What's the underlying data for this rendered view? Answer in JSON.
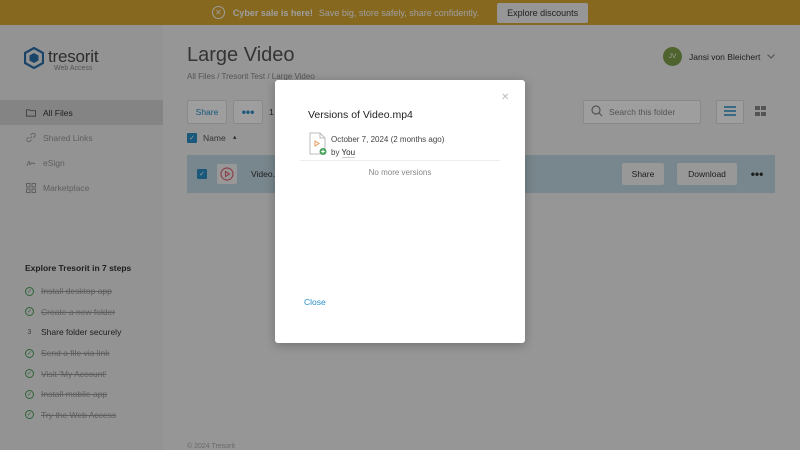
{
  "banner": {
    "bold": "Cyber sale is here!",
    "text": "Save big, store safely, share confidently.",
    "button": "Explore discounts"
  },
  "sidebar": {
    "logo": "tresorit",
    "logo_sub": "Web Access",
    "nav": [
      {
        "label": "All Files",
        "icon": "folder-icon"
      },
      {
        "label": "Shared Links",
        "icon": "link-icon"
      },
      {
        "label": "eSign",
        "icon": "signature-icon"
      },
      {
        "label": "Marketplace",
        "icon": "grid-icon"
      }
    ],
    "steps_title": "Explore Tresorit in 7 steps",
    "steps": [
      {
        "label": "Install desktop app",
        "done": true
      },
      {
        "label": "Create a new folder",
        "done": true
      },
      {
        "label": "Share folder securely",
        "done": false,
        "num": "3"
      },
      {
        "label": "Send a file via link",
        "done": true
      },
      {
        "label": "Visit 'My Account'",
        "done": true
      },
      {
        "label": "Install mobile app",
        "done": true
      },
      {
        "label": "Try the Web Access",
        "done": true
      }
    ]
  },
  "main": {
    "title": "Large Video",
    "breadcrumb": "All Files / Tresorit Test / Large Video",
    "user": {
      "initials": "JV",
      "name": "Jansi von Bleichert"
    },
    "toolbar": {
      "share": "Share",
      "more": "•••",
      "count": "1",
      "search_placeholder": "Search this folder"
    },
    "column_name": "Name",
    "file": {
      "name": "Video.m",
      "share": "Share",
      "download": "Download",
      "more": "•••"
    },
    "footer": "© 2024 Tresorit"
  },
  "modal": {
    "title": "Versions of Video.mp4",
    "version": {
      "date": "October 7, 2024 (2 months ago)",
      "by_prefix": "by",
      "by_user": "You"
    },
    "no_more": "No more versions",
    "close": "Close"
  },
  "colors": {
    "accent": "#2a8ec9",
    "banner": "#d9a833",
    "selected_row": "#c2d8e4",
    "success": "#4aa35c"
  }
}
